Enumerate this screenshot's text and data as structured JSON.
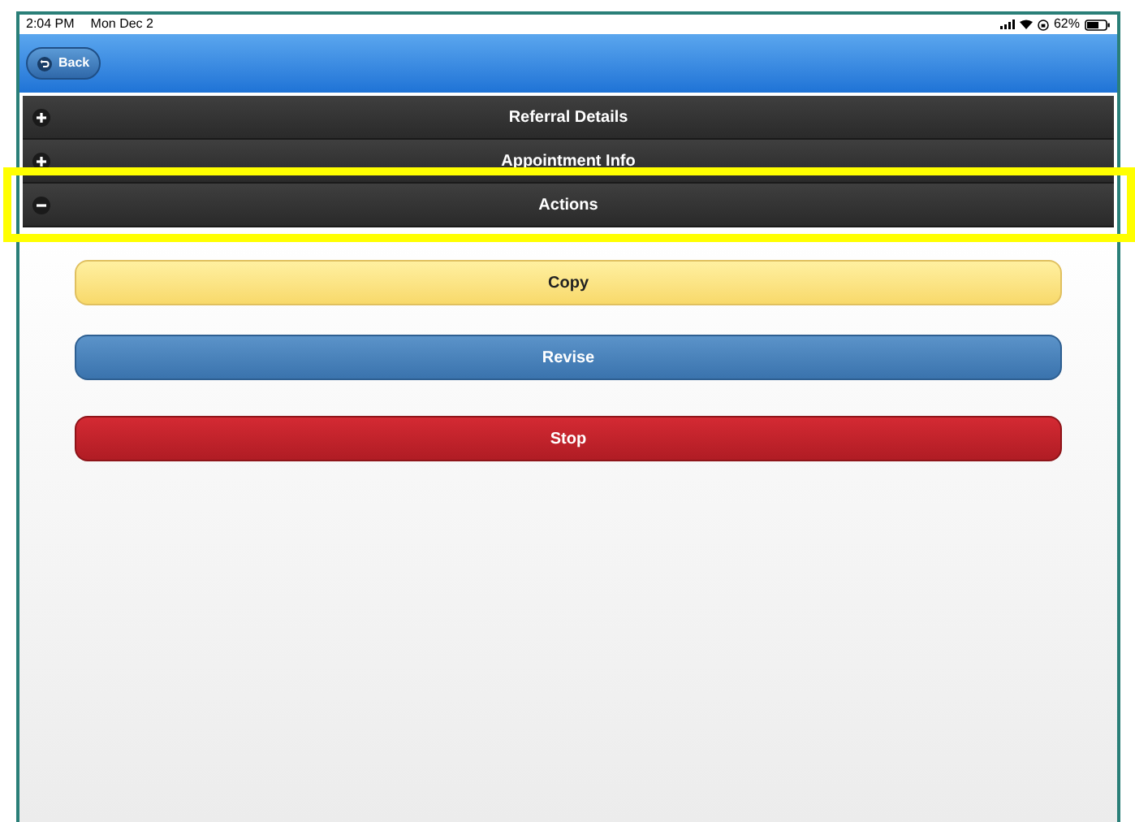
{
  "status_bar": {
    "time": "2:04 PM",
    "date": "Mon Dec 2",
    "battery": "62%"
  },
  "header": {
    "back_button": "Back"
  },
  "sections": [
    {
      "title": "Referral Details",
      "expanded": false,
      "highlighted": false
    },
    {
      "title": "Appointment Info",
      "expanded": false,
      "highlighted": false
    },
    {
      "title": "Actions",
      "expanded": true,
      "highlighted": true
    }
  ],
  "actions": [
    {
      "label": "Copy",
      "kind": "warning"
    },
    {
      "label": "Revise",
      "kind": "primary"
    },
    {
      "label": "Stop",
      "kind": "danger"
    }
  ]
}
